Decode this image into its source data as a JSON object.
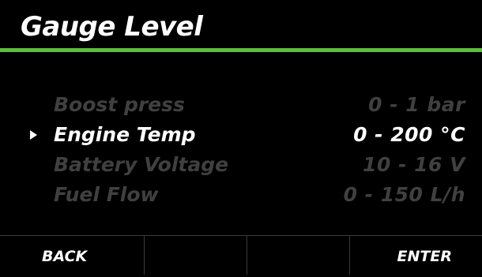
{
  "header": {
    "title": "Gauge Level"
  },
  "colors": {
    "accent": "#5cbf3a",
    "background": "#000000",
    "text_active": "#ffffff",
    "text_inactive": "#404040"
  },
  "menu": {
    "selected_index": 1,
    "pointer_icon": "triangle-right-icon",
    "items": [
      {
        "label": "Boost press",
        "range": "0 - 1 bar"
      },
      {
        "label": "Engine Temp",
        "range": "0 - 200 °C"
      },
      {
        "label": "Battery Voltage",
        "range": "10 - 16 V"
      },
      {
        "label": "Fuel Flow",
        "range": "0 - 150 L/h"
      }
    ]
  },
  "softkeys": {
    "key1": "BACK",
    "key2": "",
    "key3": "",
    "key4": "ENTER"
  }
}
